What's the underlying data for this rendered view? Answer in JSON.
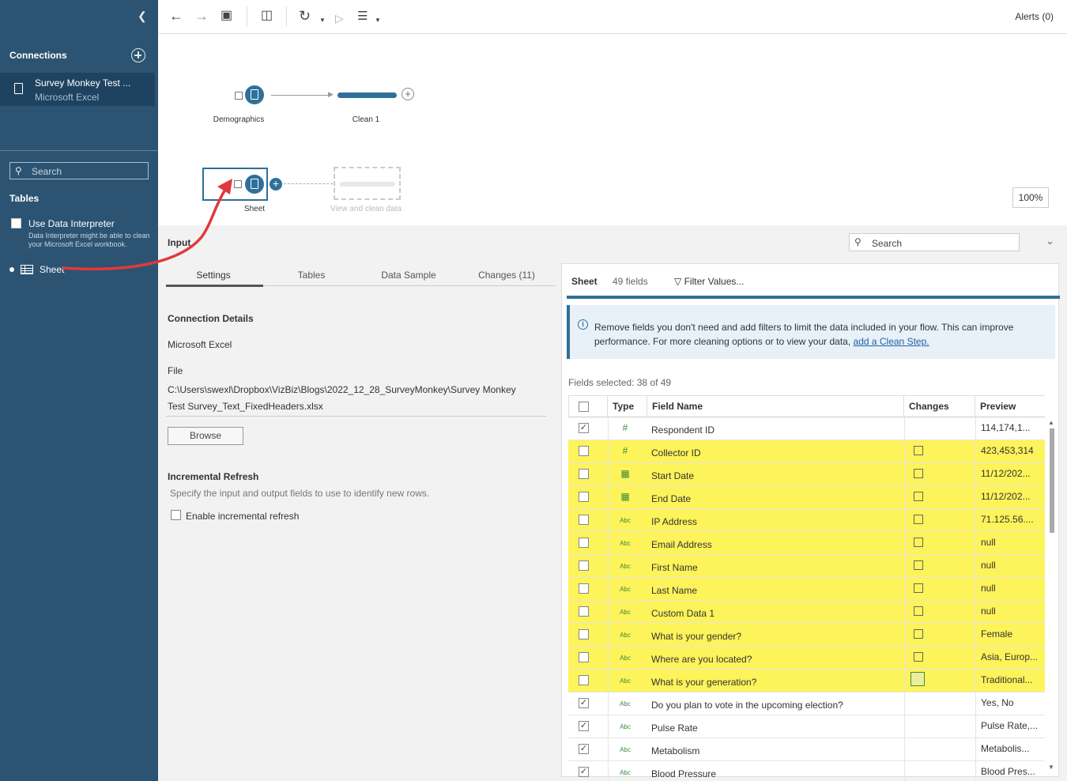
{
  "sidebar": {
    "connections_title": "Connections",
    "connection": {
      "name": "Survey Monkey Test ...",
      "type": "Microsoft Excel"
    },
    "search_placeholder": "Search",
    "tables_title": "Tables",
    "data_interpreter_label": "Use Data Interpreter",
    "data_interpreter_note": "Data Interpreter might be able to clean your Microsoft Excel workbook.",
    "sheet_label": "Sheet"
  },
  "toolbar": {
    "alerts": "Alerts (0)"
  },
  "canvas": {
    "nodes": {
      "demographics": "Demographics",
      "clean1": "Clean 1",
      "sheet": "Sheet",
      "placeholder": "View and clean data"
    },
    "zoom": "100%"
  },
  "panel": {
    "title": "Input",
    "search_placeholder": "Search",
    "tabs": [
      "Settings",
      "Tables",
      "Data Sample",
      "Changes (11)"
    ],
    "connection_details_title": "Connection Details",
    "connection_type": "Microsoft Excel",
    "file_label": "File",
    "file_path_1": "C:\\Users\\swexl\\Dropbox\\VizBiz\\Blogs\\2022_12_28_SurveyMonkey\\Survey Monkey",
    "file_path_2": "Test Survey_Text_FixedHeaders.xlsx",
    "browse": "Browse",
    "incremental_title": "Incremental Refresh",
    "incremental_desc": "Specify the input and output fields to use to identify new rows.",
    "incremental_checkbox": "Enable incremental refresh"
  },
  "fields": {
    "title": "Sheet",
    "count": "49 fields",
    "filter": "Filter Values...",
    "info_text": "Remove fields you don't need and add filters to limit the data included in your flow. This can improve performance. For more cleaning options or to view your data,",
    "info_link": "add a Clean Step.",
    "selected": "Fields selected: 38 of 49",
    "columns": [
      "Type",
      "Field Name",
      "Changes",
      "Preview"
    ],
    "rows": [
      {
        "checked": true,
        "type": "#",
        "name": "Respondent ID",
        "changed": false,
        "preview": "114,174,1...",
        "highlight": false
      },
      {
        "checked": false,
        "type": "#",
        "name": "Collector ID",
        "changed": true,
        "preview": "423,453,314",
        "highlight": true
      },
      {
        "checked": false,
        "type": "date",
        "name": "Start Date",
        "changed": true,
        "preview": "11/12/202...",
        "highlight": true
      },
      {
        "checked": false,
        "type": "date",
        "name": "End Date",
        "changed": true,
        "preview": "11/12/202...",
        "highlight": true
      },
      {
        "checked": false,
        "type": "Abc",
        "name": "IP Address",
        "changed": true,
        "preview": "71.125.56....",
        "highlight": true
      },
      {
        "checked": false,
        "type": "Abc",
        "name": "Email Address",
        "changed": true,
        "preview": "null",
        "highlight": true
      },
      {
        "checked": false,
        "type": "Abc",
        "name": "First Name",
        "changed": true,
        "preview": "null",
        "highlight": true
      },
      {
        "checked": false,
        "type": "Abc",
        "name": "Last Name",
        "changed": true,
        "preview": "null",
        "highlight": true
      },
      {
        "checked": false,
        "type": "Abc",
        "name": "Custom Data 1",
        "changed": true,
        "preview": "null",
        "highlight": true
      },
      {
        "checked": false,
        "type": "Abc",
        "name": "What is your gender?",
        "changed": true,
        "preview": "Female",
        "highlight": true
      },
      {
        "checked": false,
        "type": "Abc",
        "name": "Where are you located?",
        "changed": true,
        "preview": "Asia, Europ...",
        "highlight": true
      },
      {
        "checked": false,
        "type": "Abc",
        "name": "What is your generation?",
        "changed": true,
        "preview": "Traditional...",
        "highlight": true,
        "boxed": true
      },
      {
        "checked": true,
        "type": "Abc",
        "name": "Do you plan to vote in the upcoming election?",
        "changed": false,
        "preview": "Yes, No",
        "highlight": false
      },
      {
        "checked": true,
        "type": "Abc",
        "name": "Pulse Rate",
        "changed": false,
        "preview": "Pulse Rate,...",
        "highlight": false
      },
      {
        "checked": true,
        "type": "Abc",
        "name": "Metabolism",
        "changed": false,
        "preview": "Metabolis...",
        "highlight": false
      },
      {
        "checked": true,
        "type": "Abc",
        "name": "Blood Pressure",
        "changed": false,
        "preview": "Blood Pres...",
        "highlight": false
      }
    ]
  },
  "colors": {
    "sidebar": "#2c5472",
    "accent": "#2f6f9a",
    "highlight": "#fdf35a",
    "arrow": "#e0393c"
  }
}
